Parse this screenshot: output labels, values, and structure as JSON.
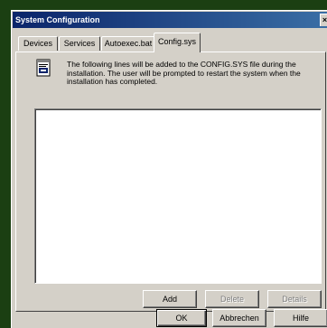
{
  "window": {
    "title": "System Configuration",
    "close_glyph": "×"
  },
  "tabs": [
    {
      "label": "Devices"
    },
    {
      "label": "Services"
    },
    {
      "label": "Autoexec.bat"
    },
    {
      "label": "Config.sys",
      "active": true
    }
  ],
  "panel": {
    "icon": "config-file-icon",
    "description": "The following lines will be added to the CONFIG.SYS file during the installation. The user will be prompted to restart the system when the installation has completed.",
    "lines": []
  },
  "panel_buttons": {
    "add": "Add",
    "delete": "Delete",
    "details": "Details"
  },
  "dialog_buttons": {
    "ok": "OK",
    "cancel": "Abbrechen",
    "help": "Hilfe"
  }
}
